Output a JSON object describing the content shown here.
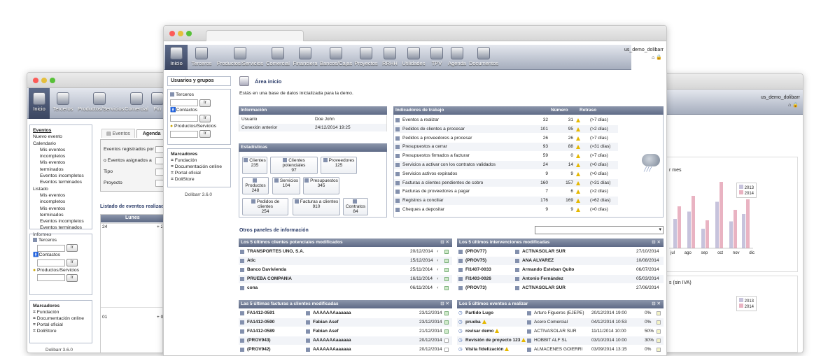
{
  "back_window": {
    "menu": [
      "Inicio",
      "Terceros",
      "Productos/Servicios",
      "Comercial",
      "Fin"
    ],
    "user": "us_demo_dolibarr",
    "left_menu": {
      "section": "Eventos",
      "items": [
        "Nuevo evento",
        "Calendario",
        "Mis eventos incompletos",
        "Mis eventos terminados",
        "Eventos incompletos",
        "Eventos terminados",
        "Listado",
        "Mis eventos incompletos",
        "Mis eventos terminados",
        "Eventos incompletos",
        "Eventos terminados",
        "Informes"
      ]
    },
    "search": {
      "terceros": "Terceros",
      "contactos": "Contactos",
      "productos": "Productos/Servicios",
      "go": "Ir"
    },
    "bookmarks": {
      "title": "Marcadores",
      "items": [
        "Fundación",
        "Documentación online",
        "Portal oficial",
        "DoliStore"
      ]
    },
    "version": "Dolibarr 3.6.0",
    "tabs": {
      "eventos": "Eventos",
      "agenda": "Agenda"
    },
    "filters": [
      "Eventos registrados por",
      "o Eventos asignados a",
      "Tipo",
      "Proyecto"
    ],
    "list_title": "Listado de eventos realizados",
    "calendar": {
      "col": "Lunes",
      "day1": "24",
      "day2": "01",
      "more1": "+ 25",
      "more2": "+ 02"
    }
  },
  "right_window": {
    "user": "us_demo_dolibarr",
    "chart1_title": "r mes",
    "chart2_title": "s (sin IVA)",
    "legend": [
      "2013",
      "2014"
    ],
    "months": [
      "jul",
      "ago",
      "sep",
      "oct",
      "nov",
      "dic"
    ]
  },
  "main_window": {
    "menu": [
      "Inicio",
      "Terceros",
      "Productos/Servicios",
      "Comercial",
      "Financiera",
      "Bancos/Cajas",
      "Proyectos",
      "RRHH",
      "Utilidades",
      "TPV",
      "Agenda",
      "Documentos"
    ],
    "user": "us_demo_dolibarr",
    "left": {
      "section": "Usuarios y grupos",
      "search": {
        "terceros": "Terceros",
        "contactos": "Contactos",
        "productos": "Productos/Servicios",
        "go": "Ir"
      },
      "bookmarks": {
        "title": "Marcadores",
        "items": [
          "Fundación",
          "Documentación online",
          "Portal oficial",
          "DoliStore"
        ]
      },
      "version": "Dolibarr 3.6.0"
    },
    "page_title": "Área inicio",
    "subtitle": "Estás en una base de datos inicializada para la demo.",
    "info": {
      "title": "Información",
      "rows": [
        {
          "label": "Usuario",
          "value": "Doe John"
        },
        {
          "label": "Conexión anterior",
          "value": "24/12/2014 19:25"
        }
      ]
    },
    "stats": {
      "title": "Estadísticas",
      "boxes": [
        {
          "label": "Clientes",
          "value": "235"
        },
        {
          "label": "Clientes potenciales",
          "value": "97"
        },
        {
          "label": "Proveedores",
          "value": "125"
        },
        {
          "label": "Productos",
          "value": "248"
        },
        {
          "label": "Servicios",
          "value": "104"
        },
        {
          "label": "Presupuestos",
          "value": "345"
        },
        {
          "label": "Pedidos de clientes",
          "value": "254"
        },
        {
          "label": "Facturas a clientes",
          "value": "910"
        },
        {
          "label": "Contratos",
          "value": "84"
        }
      ]
    },
    "indicators": {
      "title": "Indicadores de trabajo",
      "col_num": "Número",
      "col_delay": "Retraso",
      "rows": [
        {
          "label": "Eventos a realizar",
          "num": "32",
          "late": "31",
          "cond": "(>7 días)"
        },
        {
          "label": "Pedidos de clientes a procesar",
          "num": "101",
          "late": "95",
          "cond": "(>2 días)"
        },
        {
          "label": "Pedidos a proveedores a procesar",
          "num": "26",
          "late": "26",
          "cond": "(>7 días)"
        },
        {
          "label": "Presupuestos a cerrar",
          "num": "93",
          "late": "88",
          "cond": "(>31 días)"
        },
        {
          "label": "Presupuestos firmados a facturar",
          "num": "59",
          "late": "0",
          "cond": "(>7 días)"
        },
        {
          "label": "Servicios a activar con los contratos validados",
          "num": "24",
          "late": "14",
          "cond": "(>0 días)"
        },
        {
          "label": "Servicios activos expirados",
          "num": "9",
          "late": "9",
          "cond": "(>0 días)"
        },
        {
          "label": "Facturas a clientes pendientes de cobro",
          "num": "160",
          "late": "157",
          "cond": "(>31 días)"
        },
        {
          "label": "Facturas de proveedores a pagar",
          "num": "7",
          "late": "6",
          "cond": "(>2 días)"
        },
        {
          "label": "Registros a conciliar",
          "num": "176",
          "late": "169",
          "cond": "(>62 días)"
        },
        {
          "label": "Cheques a depositar",
          "num": "9",
          "late": "9",
          "cond": "(>0 días)"
        }
      ]
    },
    "other_panels": "Otros paneles de información",
    "panel_prospects": {
      "title": "Los 5 últimos clientes potenciales modificados",
      "rows": [
        {
          "name": "TRANSPORTES UNO, S.A.",
          "date": "20/12/2014"
        },
        {
          "name": "Atic",
          "date": "15/12/2014"
        },
        {
          "name": "Banco Davivienda",
          "date": "25/11/2014"
        },
        {
          "name": "PRUEBA COMPANIA",
          "date": "16/11/2014"
        },
        {
          "name": "cona",
          "date": "06/11/2014"
        }
      ]
    },
    "panel_interventions": {
      "title": "Los 5 últimos intervenciones modificadas",
      "rows": [
        {
          "ref": "(PROV77)",
          "company": "ACTIVASOLAR SUR",
          "date": "27/10/2014"
        },
        {
          "ref": "(PROV75)",
          "company": "ANA ALVAREZ",
          "date": "10/08/2014"
        },
        {
          "ref": "FI1407-0033",
          "company": "Armando Esteban Quito",
          "date": "06/07/2014"
        },
        {
          "ref": "FI1403-0026",
          "company": "Antonio Fernández",
          "date": "05/03/2014"
        },
        {
          "ref": "(PROV73)",
          "company": "ACTIVASOLAR SUR",
          "date": "27/06/2014"
        }
      ]
    },
    "panel_invoices": {
      "title": "Las 5 últimas facturas a clientes modificadas",
      "rows": [
        {
          "ref": "FA1412-0591",
          "company": "AAAAAAAaaaaaa",
          "date": "23/12/2014"
        },
        {
          "ref": "FA1412-0590",
          "company": "Fabian Asef",
          "date": "23/12/2014"
        },
        {
          "ref": "FA1412-0589",
          "company": "Fabian Asef",
          "date": "21/12/2014"
        },
        {
          "ref": "(PROV943)",
          "company": "AAAAAAAaaaaaa",
          "date": "20/12/2014"
        },
        {
          "ref": "(PROV942)",
          "company": "AAAAAAAaaaaaa",
          "date": "20/12/2014"
        }
      ]
    },
    "panel_events": {
      "title": "Los 5 últimos eventos a realizar",
      "rows": [
        {
          "name": "Partido Lugo",
          "who": "Arturo Figueros (EJEPE)",
          "date": "20/12/2014 19:00",
          "pct": "0%"
        },
        {
          "name": "prueba",
          "who": "Acero Comercial",
          "date": "04/12/2014 10:53",
          "pct": "0%"
        },
        {
          "name": "revisar demo",
          "who": "ACTIVASOLAR SUR",
          "date": "11/11/2014 10:00",
          "pct": "50%"
        },
        {
          "name": "Revisión de proyecto 123",
          "who": "HOBBIT ALF SL",
          "date": "03/10/2014 10:00",
          "pct": "30%"
        },
        {
          "name": "Visita fidelización",
          "who": "ALMACENES GOIERRI",
          "date": "03/09/2014 13:15",
          "pct": "0%"
        }
      ]
    }
  }
}
